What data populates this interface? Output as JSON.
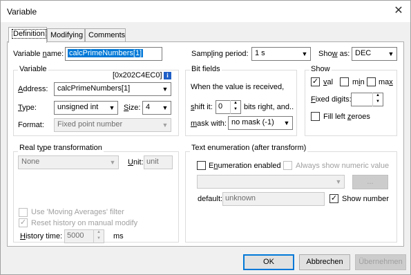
{
  "window": {
    "title": "Variable",
    "close_label": "✕"
  },
  "tabs": [
    {
      "label": "Definition",
      "active": true
    },
    {
      "label": "Modifying",
      "active": false
    },
    {
      "label": "Comments",
      "active": false
    }
  ],
  "top": {
    "variable_name_label": "Variable name:",
    "variable_name_value": "calcPrimeNumbers[1]",
    "sampling_label": "Sampling period:",
    "sampling_value": "1 s",
    "show_as_label": "Show as:",
    "show_as_value": "DEC"
  },
  "variable_group": {
    "title": "Variable",
    "address_hex": "[0x202C4EC0]",
    "info_icon": "i",
    "address_label": "Address:",
    "address_value": "calcPrimeNumbers[1]",
    "type_label": "Type:",
    "type_value": "unsigned int",
    "size_label": "Size:",
    "size_value": "4",
    "format_label": "Format:",
    "format_value": "Fixed point number"
  },
  "bitfields_group": {
    "title": "Bit fields",
    "description": "When the value is received,",
    "shift_label": "shift it:",
    "shift_value": "0",
    "shift_suffix": "bits right, and..",
    "mask_label": "mask with:",
    "mask_value": "no mask (-1)"
  },
  "show_group": {
    "title": "Show",
    "val_label": "val",
    "val_checked": true,
    "min_label": "min",
    "min_checked": false,
    "max_label": "max",
    "max_checked": false,
    "fixed_digits_label": "Fixed digits:",
    "fixed_digits_value": "",
    "fill_left_label": "Fill left zeroes",
    "fill_left_checked": false
  },
  "real_type_group": {
    "title": "Real type transformation",
    "type_value": "None",
    "unit_label": "Unit:",
    "unit_value": "unit",
    "moving_avg_label": "Use 'Moving Averages' filter",
    "reset_history_label": "Reset history on manual modify",
    "history_time_label": "History time:",
    "history_time_value": "5000",
    "history_unit": "ms"
  },
  "text_enum_group": {
    "title": "Text enumeration (after transform)",
    "enum_enabled_label": "Enumeration enabled",
    "always_numeric_label": "Always show numeric value",
    "enum_combo_value": "",
    "ellipsis_label": "...",
    "default_label": "default:",
    "default_value": "unknown",
    "show_number_label": "Show number",
    "show_number_checked": true
  },
  "buttons": {
    "ok": "OK",
    "cancel": "Abbrechen",
    "apply": "Übernehmen"
  }
}
